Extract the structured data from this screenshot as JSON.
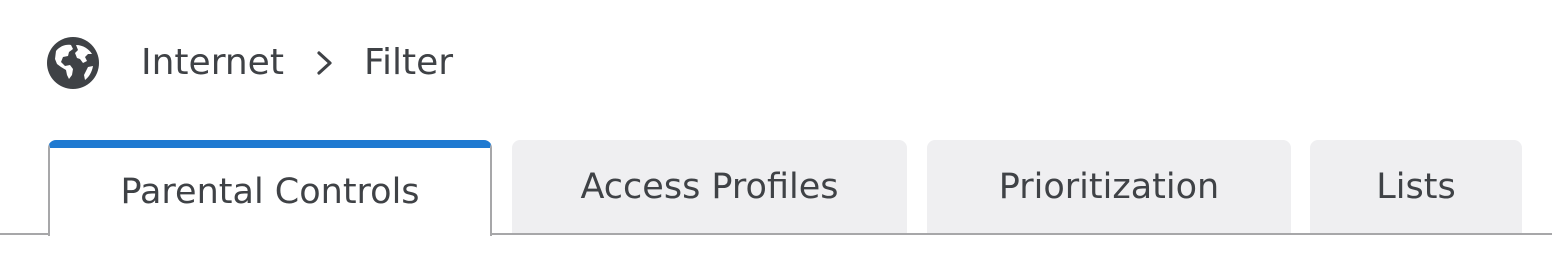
{
  "breadcrumb": {
    "icon": "globe-icon",
    "items": [
      "Internet",
      "Filter"
    ],
    "separator_icon": "chevron-right-icon"
  },
  "tabs": [
    {
      "label": "Parental Controls",
      "active": true
    },
    {
      "label": "Access Profiles",
      "active": false
    },
    {
      "label": "Prioritization",
      "active": false
    },
    {
      "label": "Lists",
      "active": false
    }
  ],
  "colors": {
    "accent": "#1f7ad1",
    "text": "#3f4246",
    "tab_inactive_bg": "#efeff1",
    "border": "#a7a7a9"
  }
}
